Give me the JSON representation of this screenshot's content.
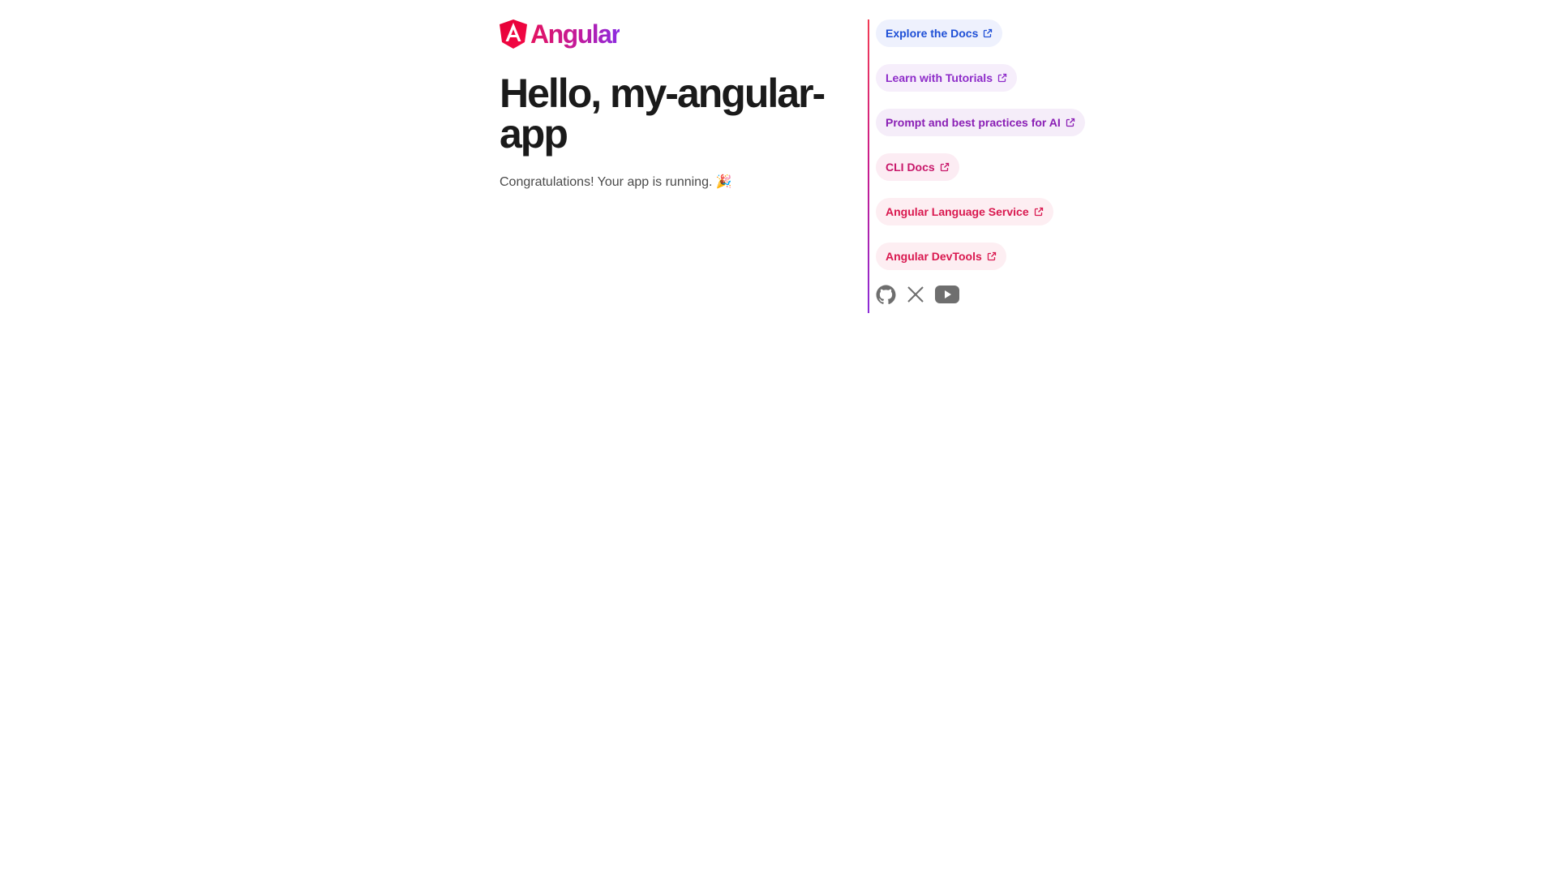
{
  "brand": {
    "logo_text": "Angular"
  },
  "main": {
    "title": "Hello, my-angular-app",
    "subtitle": "Congratulations! Your app is running. 🎉"
  },
  "links": [
    {
      "label": "Explore the Docs",
      "color": "#1e4fd6",
      "bg": "#eef1fd"
    },
    {
      "label": "Learn with Tutorials",
      "color": "#8e2cc9",
      "bg": "#f6eefb"
    },
    {
      "label": "Prompt and best practices for AI",
      "color": "#8a1fb5",
      "bg": "#f5edf9"
    },
    {
      "label": "CLI Docs",
      "color": "#c8176a",
      "bg": "#fcecf3"
    },
    {
      "label": "Angular Language Service",
      "color": "#d9184f",
      "bg": "#fdeef2"
    },
    {
      "label": "Angular DevTools",
      "color": "#d9184f",
      "bg": "#fdeef2"
    }
  ],
  "social": [
    {
      "icon": "github-icon"
    },
    {
      "icon": "x-twitter-icon"
    },
    {
      "icon": "youtube-icon"
    }
  ],
  "colors": {
    "icon_gray": "#6e6e6e",
    "logo_red": "#dd0031"
  }
}
